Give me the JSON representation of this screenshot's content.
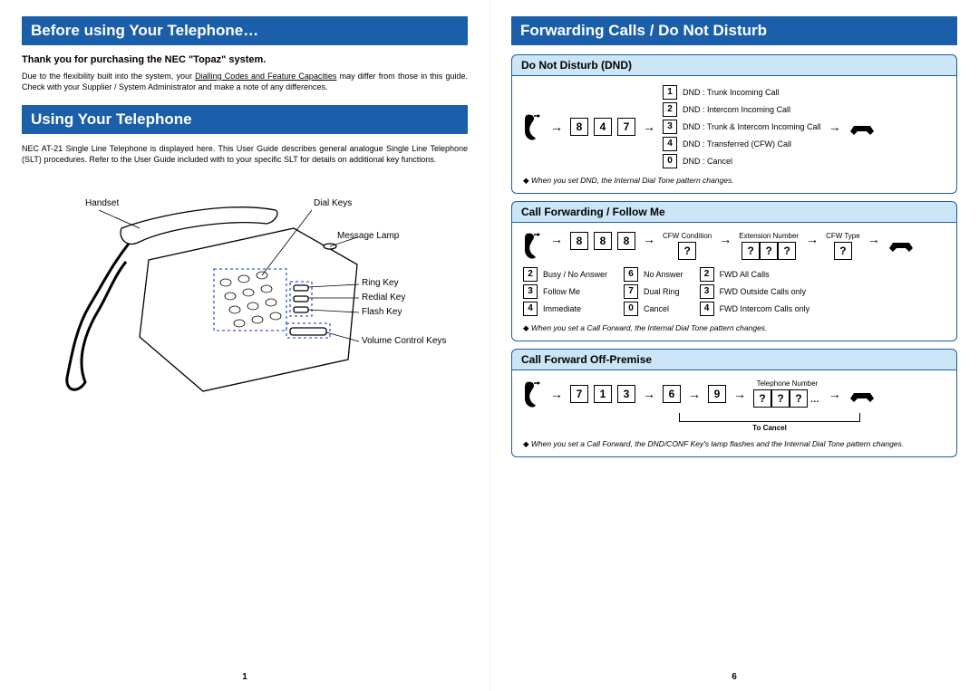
{
  "left": {
    "header1": "Before using Your Telephone…",
    "thank": "Thank you for purchasing the NEC \"Topaz\" system.",
    "intro1_a": "Due to the flexibility built into the system, your ",
    "intro1_ul": "Dialling Codes and Feature Capacities",
    "intro1_b": " may differ from those in this guide. Check with your Supplier / System Administrator and make a note of any differences.",
    "header2": "Using Your Telephone",
    "intro2": "NEC AT-21 Single Line Telephone is displayed here. This User Guide describes general analogue Single Line Telephone (SLT) procedures. Refer to the User Guide included with to your specific SLT for details on additional key functions.",
    "labels": {
      "handset": "Handset",
      "dialkeys": "Dial Keys",
      "message": "Message Lamp",
      "ring": "Ring Key",
      "redial": "Redial Key",
      "flash": "Flash Key",
      "volume": "Volume Control Keys"
    },
    "pagenum": "1"
  },
  "right": {
    "header": "Forwarding Calls / Do Not Disturb",
    "dnd": {
      "title": "Do Not Disturb (DND)",
      "code": [
        "8",
        "4",
        "7"
      ],
      "opts": [
        {
          "k": "1",
          "t": "DND : Trunk Incoming Call"
        },
        {
          "k": "2",
          "t": "DND : Intercom Incoming Call"
        },
        {
          "k": "3",
          "t": "DND : Trunk & Intercom Incoming Call"
        },
        {
          "k": "4",
          "t": "DND : Transferred (CFW) Call"
        },
        {
          "k": "0",
          "t": "DND : Cancel"
        }
      ],
      "note": "When you set DND, the Internal Dial Tone pattern changes."
    },
    "cfw": {
      "title": "Call Forwarding / Follow Me",
      "code": [
        "8",
        "8",
        "8"
      ],
      "hdr1": "CFW Condition",
      "hdr2": "Extension Number",
      "hdr3": "CFW Type",
      "col1": [
        {
          "k": "2",
          "t": "Busy / No Answer"
        },
        {
          "k": "3",
          "t": "Follow Me"
        },
        {
          "k": "4",
          "t": "Immediate"
        }
      ],
      "col2": [
        {
          "k": "6",
          "t": "No Answer"
        },
        {
          "k": "7",
          "t": "Dual Ring"
        },
        {
          "k": "0",
          "t": "Cancel"
        }
      ],
      "col3": [
        {
          "k": "2",
          "t": "FWD All Calls"
        },
        {
          "k": "3",
          "t": "FWD Outside Calls only"
        },
        {
          "k": "4",
          "t": "FWD Intercom Calls only"
        }
      ],
      "note": "When you set a Call Forward, the Internal Dial Tone pattern changes."
    },
    "off": {
      "title": "Call Forward Off-Premise",
      "code1": [
        "7",
        "1",
        "3"
      ],
      "six": "6",
      "nine": "9",
      "telnum": "Telephone Number",
      "tocancel": "To Cancel",
      "note": "When you set a Call Forward, the DND/CONF Key's lamp flashes and the Internal Dial Tone pattern changes."
    },
    "pagenum": "6"
  }
}
